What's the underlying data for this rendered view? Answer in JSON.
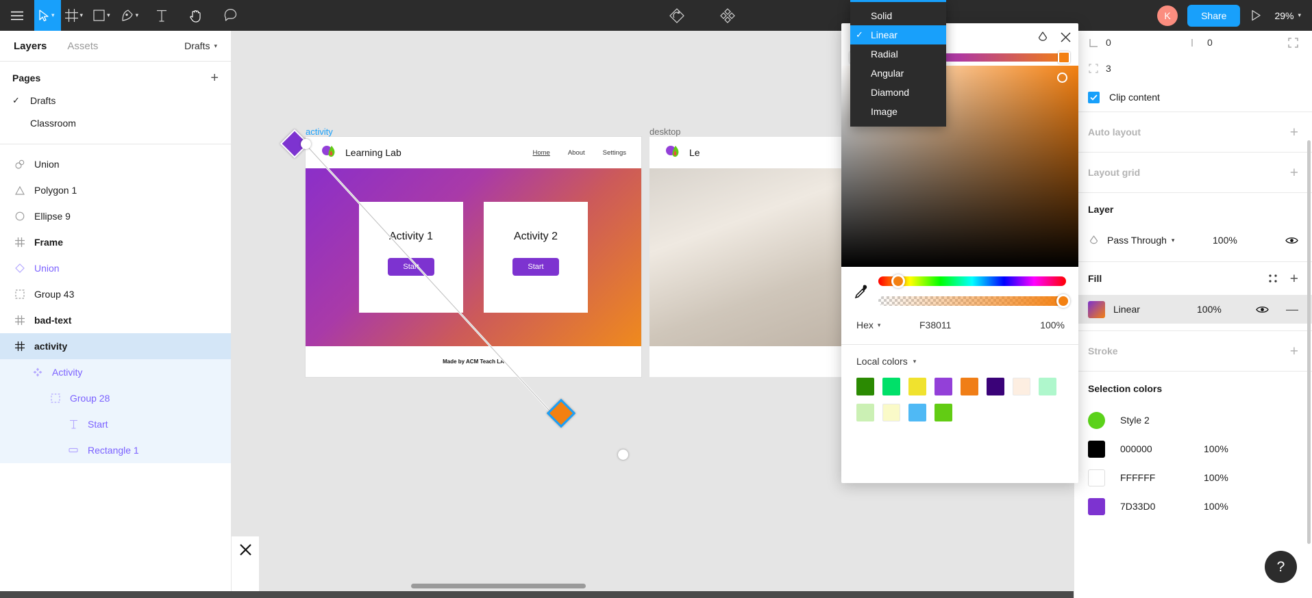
{
  "toolbar": {
    "menu_label": "menu",
    "tools": [
      {
        "name": "move-tool",
        "icon": "cursor-arrow",
        "active": true,
        "has_caret": true
      },
      {
        "name": "frame-tool",
        "icon": "frame-hash",
        "active": false,
        "has_caret": true
      },
      {
        "name": "shape-tool",
        "icon": "square",
        "active": false,
        "has_caret": true
      },
      {
        "name": "pen-tool",
        "icon": "pen",
        "active": false,
        "has_caret": true
      },
      {
        "name": "text-tool",
        "icon": "text-t",
        "active": false,
        "has_caret": false
      },
      {
        "name": "hand-tool",
        "icon": "hand",
        "active": false,
        "has_caret": false
      },
      {
        "name": "comment-tool",
        "icon": "comment-bubble",
        "active": false,
        "has_caret": false
      }
    ],
    "components_icon": "component-diamond",
    "plugins_icon": "plugin-four-diamonds",
    "avatar_initial": "K",
    "share_label": "Share",
    "present_icon": "play-triangle",
    "zoom_level": "29%",
    "accent_blue": "#18a0fb",
    "avatar_color": "#fb8d7f"
  },
  "left_panel": {
    "tabs": [
      {
        "label": "Layers",
        "selected": true
      },
      {
        "label": "Assets",
        "selected": false
      }
    ],
    "file_name": "Drafts",
    "pages_title": "Pages",
    "add_page_label": "+",
    "pages": [
      {
        "label": "Drafts",
        "checked": true
      },
      {
        "label": "Classroom",
        "checked": false
      }
    ],
    "layers": [
      {
        "label": "Union",
        "icon": "union-icon",
        "indent": 0,
        "state": "normal"
      },
      {
        "label": "Polygon 1",
        "icon": "triangle-icon",
        "indent": 0,
        "state": "normal"
      },
      {
        "label": "Ellipse 9",
        "icon": "circle-icon",
        "indent": 0,
        "state": "normal"
      },
      {
        "label": "Frame",
        "icon": "frame-icon",
        "indent": 0,
        "state": "bold"
      },
      {
        "label": "Union",
        "icon": "diamond-icon",
        "indent": 0,
        "state": "purple"
      },
      {
        "label": "Group 43",
        "icon": "group-icon",
        "indent": 0,
        "state": "normal"
      },
      {
        "label": "bad-text",
        "icon": "frame-icon",
        "indent": 0,
        "state": "bold"
      },
      {
        "label": "activity",
        "icon": "frame-icon",
        "indent": 0,
        "state": "selected"
      },
      {
        "label": "Activity",
        "icon": "component-icon",
        "indent": 1,
        "state": "child"
      },
      {
        "label": "Group 28",
        "icon": "group-icon",
        "indent": 2,
        "state": "child"
      },
      {
        "label": "Start",
        "icon": "text-icon",
        "indent": 3,
        "state": "child"
      },
      {
        "label": "Rectangle 1",
        "icon": "rectangle-icon",
        "indent": 3,
        "state": "child"
      }
    ]
  },
  "canvas": {
    "frame_label": "activity",
    "frame2_label": "desktop",
    "artboard": {
      "brand": "Learning Lab",
      "nav_links": [
        "Home",
        "About",
        "Settings"
      ],
      "cards": [
        {
          "title": "Activity 1",
          "button": "Start"
        },
        {
          "title": "Activity 2",
          "button": "Start"
        }
      ],
      "footer": "Made by ACM Teach LA",
      "gradient_start": "#7D33D0",
      "gradient_end": "#F38011"
    },
    "artboard2": {
      "brand": "Le"
    },
    "close_icon": "close-x-icon"
  },
  "gradient_menu": {
    "items": [
      {
        "label": "Solid",
        "selected": false
      },
      {
        "label": "Linear",
        "selected": true
      },
      {
        "label": "Radial",
        "selected": false
      },
      {
        "label": "Angular",
        "selected": false
      },
      {
        "label": "Diamond",
        "selected": false
      },
      {
        "label": "Image",
        "selected": false
      }
    ]
  },
  "color_picker": {
    "type_label": "Linear",
    "rotate_icon": "rotate-icon",
    "close_icon": "close-x-icon",
    "stops": [
      {
        "color": "#7D33D0",
        "position_pct": 0
      },
      {
        "color": "#F38011",
        "position_pct": 100
      }
    ],
    "eyedropper_icon": "eyedropper-icon",
    "hue_pct": 7,
    "alpha_pct": 100,
    "hex_mode": "Hex",
    "hex_value": "F38011",
    "alpha_value": "100%",
    "local_colors_label": "Local colors",
    "local_colors": [
      "#2B8A02",
      "#00E069",
      "#F0E22E",
      "#9340D8",
      "#F07E17",
      "#3A0278",
      "#FDEEE1",
      "#AFF7CC",
      "#CBF0B4",
      "#FAFAC8",
      "#4FB9F5",
      "#62CC14"
    ]
  },
  "right_panel": {
    "position": {
      "x_label": "0",
      "y_label": "0",
      "constrain_icon": "constrain-icon"
    },
    "corner_radius": "3",
    "clip_content_label": "Clip content",
    "clip_content_checked": true,
    "auto_layout_label": "Auto layout",
    "layout_grid_label": "Layout grid",
    "layer_section": {
      "title": "Layer",
      "blend_mode": "Pass Through",
      "opacity": "100%",
      "visible_icon": "eye-icon"
    },
    "fill_section": {
      "title": "Fill",
      "fills": [
        {
          "name": "Linear",
          "opacity": "100%",
          "type": "gradient",
          "from": "#7D33D0",
          "to": "#F38011"
        }
      ]
    },
    "stroke_section": {
      "title": "Stroke"
    },
    "selection_colors": {
      "title": "Selection colors",
      "items": [
        {
          "swatch": "#5BD21A",
          "label": "Style 2",
          "opacity": "",
          "shape": "circle"
        },
        {
          "swatch": "#000000",
          "label": "000000",
          "opacity": "100%",
          "shape": "square"
        },
        {
          "swatch": "#FFFFFF",
          "label": "FFFFFF",
          "opacity": "100%",
          "shape": "square"
        },
        {
          "swatch": "#7D33D0",
          "label": "7D33D0",
          "opacity": "100%",
          "shape": "square"
        }
      ]
    },
    "help_label": "?"
  }
}
